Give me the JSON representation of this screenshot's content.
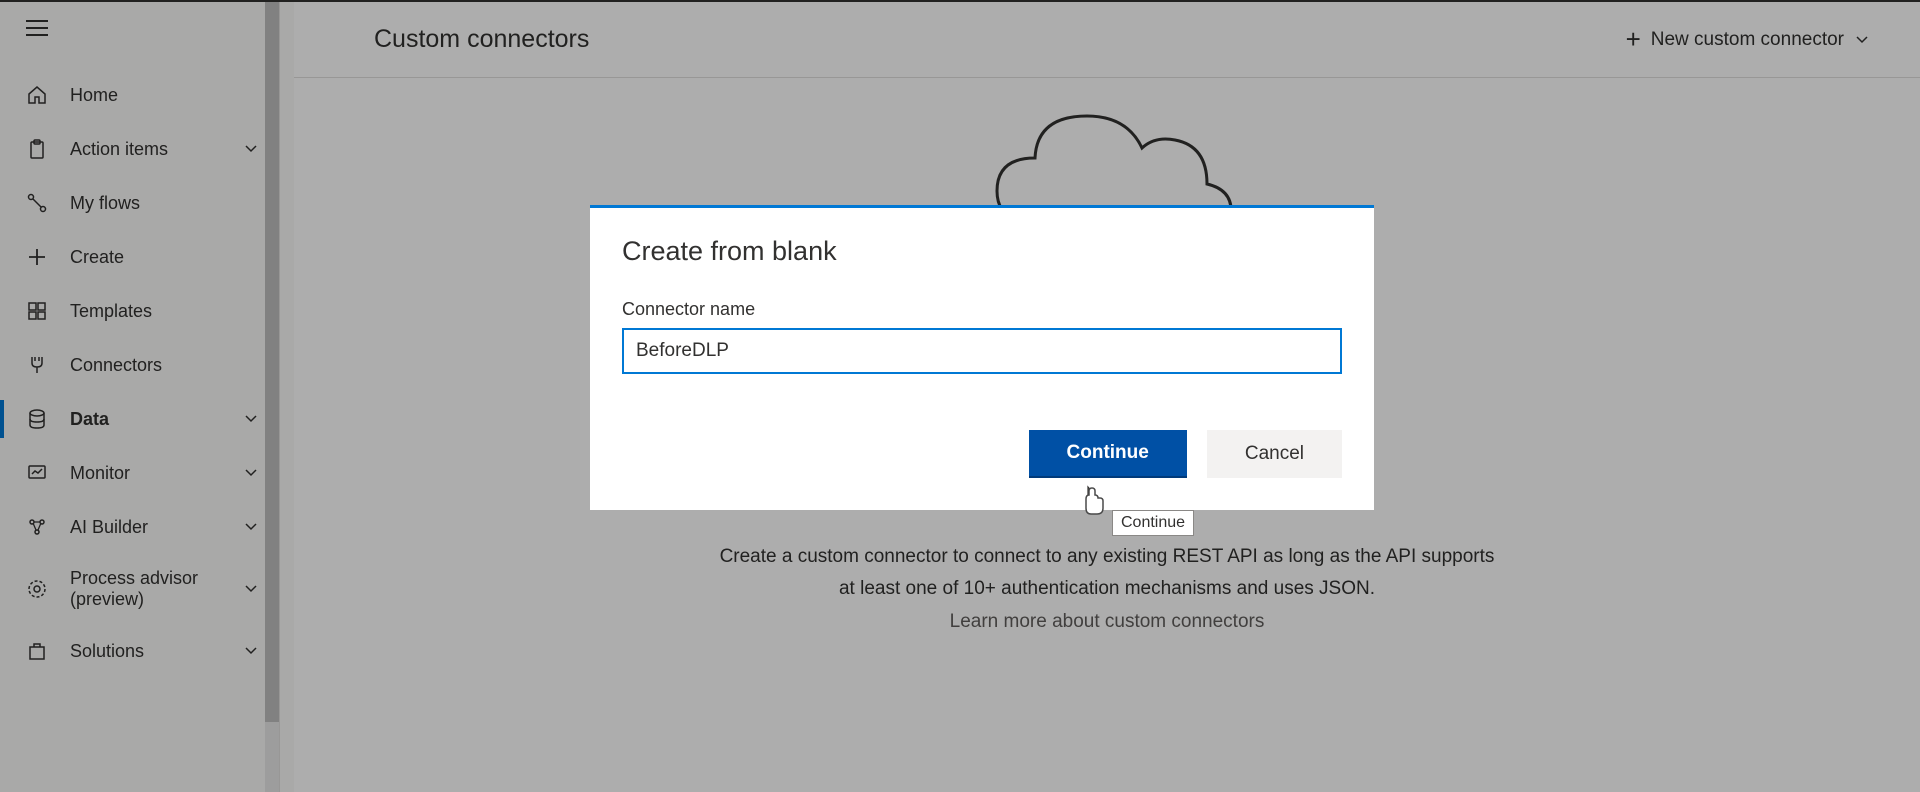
{
  "sidebar": {
    "items": [
      {
        "label": "Home",
        "icon": "home",
        "expandable": false,
        "active": false
      },
      {
        "label": "Action items",
        "icon": "clipboard",
        "expandable": true,
        "active": false
      },
      {
        "label": "My flows",
        "icon": "flow",
        "expandable": false,
        "active": false
      },
      {
        "label": "Create",
        "icon": "plus",
        "expandable": false,
        "active": false
      },
      {
        "label": "Templates",
        "icon": "template",
        "expandable": false,
        "active": false
      },
      {
        "label": "Connectors",
        "icon": "connector",
        "expandable": false,
        "active": false
      },
      {
        "label": "Data",
        "icon": "data",
        "expandable": true,
        "active": true
      },
      {
        "label": "Monitor",
        "icon": "monitor",
        "expandable": true,
        "active": false
      },
      {
        "label": "AI Builder",
        "icon": "ai",
        "expandable": true,
        "active": false
      },
      {
        "label": "Process advisor (preview)",
        "icon": "process",
        "expandable": true,
        "active": false
      },
      {
        "label": "Solutions",
        "icon": "solutions",
        "expandable": true,
        "active": false
      }
    ]
  },
  "header": {
    "title": "Custom connectors",
    "new_button_label": "New custom connector"
  },
  "empty_state": {
    "line1": "Create a custom connector to connect to any existing REST API as long as the API supports",
    "line2": "at least one of 10+ authentication mechanisms and uses JSON.",
    "learn_more": "Learn more about custom connectors"
  },
  "modal": {
    "title": "Create from blank",
    "field_label": "Connector name",
    "input_value": "BeforeDLP",
    "continue_label": "Continue",
    "cancel_label": "Cancel"
  },
  "tooltip": {
    "text": "Continue"
  }
}
